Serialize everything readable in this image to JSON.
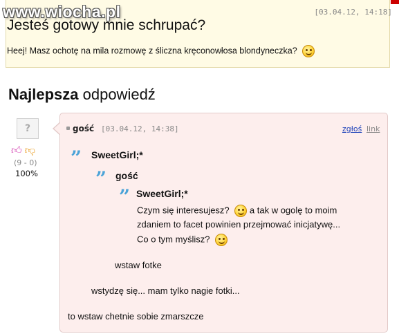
{
  "watermark": "www.wiocha.pl",
  "question": {
    "date": "[03.04.12, 14:18]",
    "title": "Jesteś gotowy mnie schrupać?",
    "body": "Heej! Masz ochotę na mila rozmowę z śliczna kręconowłosa blondyneczka?"
  },
  "best_answer": {
    "heading_bold": "Najlepsza",
    "heading_rest": " odpowiedź",
    "votes": "(9 - 0)",
    "percent": "100%",
    "author": "gość",
    "date": "[03.04.12, 14:38]",
    "report_link": "zgłoś",
    "perma_link": "link",
    "quotes": {
      "q1": "SweetGirl;*",
      "q2": "gość",
      "q3": "SweetGirl;*"
    },
    "lines": {
      "l1": "Czym się interesujesz?",
      "l1b": "a tak w ogolę to moim",
      "l2": "zdaniem to facet powinien przejmować inicjatywę...",
      "l3": "Co o tym myślisz?",
      "l4": "wstaw fotke",
      "l5": "wstydzę się... mam tylko nagie fotki...",
      "l6": "to wstaw chetnie sobie zmarszcze"
    }
  },
  "icons": [
    "smiley-icon",
    "avatar-icon",
    "thumb-up-icon",
    "thumb-down-icon",
    "quote-icon",
    "bullet-icon"
  ],
  "colors": {
    "question_bg": "#fffbe5",
    "answer_bg": "#fdeeed",
    "link_blue": "#1a3fb8",
    "quote_blue": "#4aa3d8",
    "thumb_up": "#d23fb0",
    "thumb_down": "#e89a1c"
  }
}
